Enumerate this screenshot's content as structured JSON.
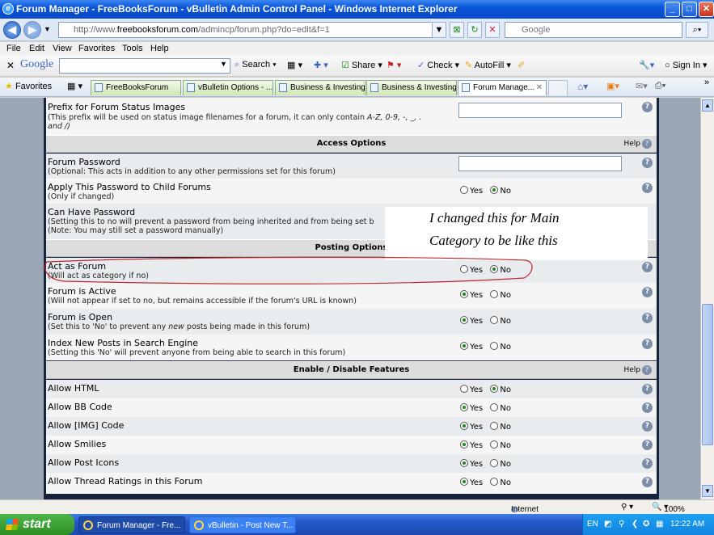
{
  "window": {
    "title": "Forum Manager - FreeBooksForum - vBulletin Admin Control Panel - Windows Internet Explorer",
    "controls": [
      "minimize",
      "maximize",
      "close"
    ]
  },
  "address_bar": {
    "url_prefix": "http://www.",
    "url_domain": "freebooksforum.com",
    "url_rest": "/admincp/forum.php?do=edit&f=1",
    "search_placeholder": "Google"
  },
  "menu": [
    "File",
    "Edit",
    "View",
    "Favorites",
    "Tools",
    "Help"
  ],
  "google_toolbar": {
    "logo": "Google",
    "search_label": "Search",
    "share_label": "Share",
    "check_label": "Check",
    "autofill_label": "AutoFill",
    "signin_label": "Sign In"
  },
  "favorites_bar": {
    "favorites_label": "Favorites",
    "tabs": [
      "FreeBooksForum",
      "vBulletin Options - ...",
      "Business & Investing",
      "Business & Investing",
      "Forum Manage..."
    ],
    "active_tab": 4
  },
  "form": {
    "prefix_row": {
      "label": "Prefix for Forum Status Images",
      "desc1_pre": "(This prefix will be used on status image filenames for a forum, it can only contain ",
      "desc1_em": "A-Z, 0-9, -, _, .",
      "desc2": "and /)"
    },
    "sections": {
      "access": "Access Options",
      "posting": "Posting Options",
      "features": "Enable / Disable Features"
    },
    "help_label": "Help",
    "yes_label": "Yes",
    "no_label": "No",
    "forum_password": {
      "label": "Forum Password",
      "desc": "(Optional: This acts in addition to any other permissions set for this forum)"
    },
    "apply_password": {
      "label": "Apply This Password to Child Forums",
      "desc": "(Only if changed)",
      "value": "No"
    },
    "can_have_password": {
      "label": "Can Have Password",
      "desc1": "(Setting this to no will prevent a password from being inherited and from being set b",
      "desc2": "(Note: You may still set a password manually)"
    },
    "act_as_forum": {
      "label": "Act as Forum",
      "desc": "(Will act as category if no)",
      "value": "No"
    },
    "forum_active": {
      "label": "Forum is Active",
      "desc": "(Will not appear if set to no, but remains accessible if the forum's URL is known)",
      "value": "Yes"
    },
    "forum_open": {
      "label": "Forum is Open",
      "desc_pre": "(Set this to 'No' to prevent any ",
      "desc_em": "new",
      "desc_post": " posts being made in this forum)",
      "value": "Yes"
    },
    "index_posts": {
      "label": "Index New Posts in Search Engine",
      "desc": "(Setting this 'No' will prevent anyone from being able to search in this forum)",
      "value": "Yes"
    },
    "features": [
      {
        "label": "Allow HTML",
        "value": "No"
      },
      {
        "label": "Allow BB Code",
        "value": "Yes"
      },
      {
        "label": "Allow [IMG] Code",
        "value": "Yes"
      },
      {
        "label": "Allow Smilies",
        "value": "Yes"
      },
      {
        "label": "Allow Post Icons",
        "value": "Yes"
      },
      {
        "label": "Allow Thread Ratings in this Forum",
        "value": "Yes"
      }
    ]
  },
  "annotation": {
    "line1": "I changed this for Main",
    "line2": "Category to be like this",
    "circle_color": "#c0262a"
  },
  "status_bar": {
    "zone": "Internet",
    "zoom": "100%"
  },
  "taskbar": {
    "start_label": "start",
    "tasks": [
      "Forum Manager - Fre...",
      "vBulletin - Post New T..."
    ],
    "lang": "EN",
    "time": "12:22 AM"
  }
}
